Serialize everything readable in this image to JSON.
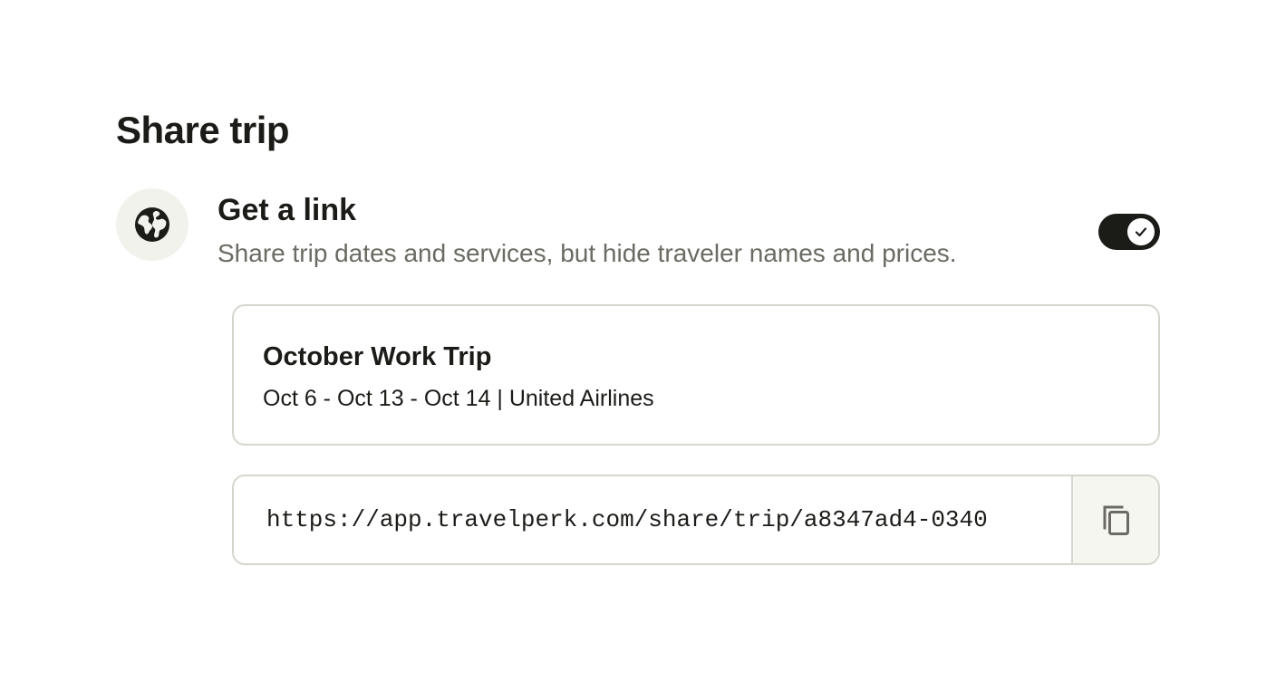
{
  "header": {
    "title": "Share trip"
  },
  "share_option": {
    "icon": "globe-icon",
    "title": "Get a link",
    "description": "Share trip dates and services, but hide traveler names and prices.",
    "toggle_enabled": true,
    "toggle_icon": "checkmark-icon"
  },
  "trip": {
    "name": "October Work Trip",
    "details": "Oct 6 - Oct 13 - Oct 14 | United Airlines"
  },
  "share_link": {
    "url": "https://app.travelperk.com/share/trip/a8347ad4-0340",
    "copy_icon": "copy-icon"
  },
  "colors": {
    "text_primary": "#1b1b18",
    "text_secondary": "#6b6b63",
    "toggle_on": "#1b1b18",
    "border": "#d6d6cf",
    "badge_background": "#f2f2ec"
  }
}
